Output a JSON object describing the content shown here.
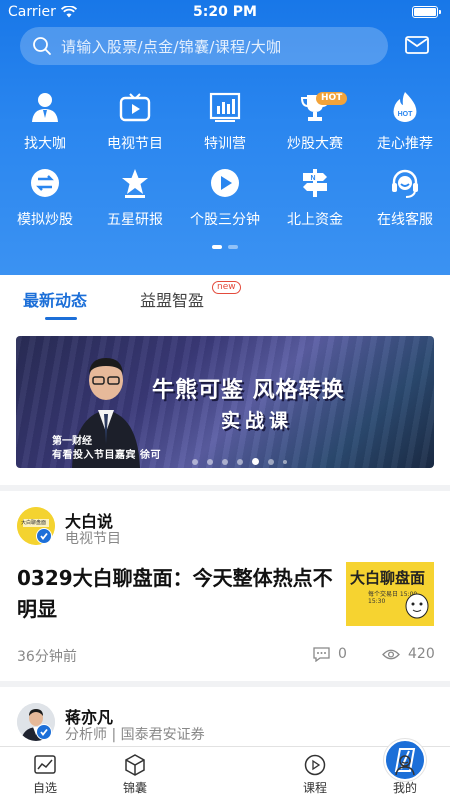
{
  "status_bar": {
    "carrier": "Carrier",
    "time": "5:20 PM"
  },
  "search": {
    "placeholder": "请输入股票/点金/锦囊/课程/大咖"
  },
  "grid": {
    "row1": [
      {
        "label": "找大咖",
        "icon": "person-icon"
      },
      {
        "label": "电视节目",
        "icon": "tv-icon"
      },
      {
        "label": "特训营",
        "icon": "chart-board-icon"
      },
      {
        "label": "炒股大赛",
        "icon": "trophy-icon",
        "badge": "HOT"
      },
      {
        "label": "走心推荐",
        "icon": "hot-flame-icon"
      }
    ],
    "row2": [
      {
        "label": "模拟炒股",
        "icon": "exchange-icon"
      },
      {
        "label": "五星研报",
        "icon": "star-icon"
      },
      {
        "label": "个股三分钟",
        "icon": "play-icon"
      },
      {
        "label": "北上资金",
        "icon": "signpost-icon"
      },
      {
        "label": "在线客服",
        "icon": "headset-icon"
      }
    ]
  },
  "tabs": {
    "active": "最新动态",
    "inactive": "益盟智盈",
    "new_badge": "new"
  },
  "banner": {
    "headline": "牛熊可鉴  风格转换",
    "subtitle": "实战课",
    "caption1": "第一财经",
    "caption2": "有看投入节目嘉宾  徐可"
  },
  "card1": {
    "author": "大白说",
    "author_sub": "电视节目",
    "title": "0329大白聊盘面：今天整体热点不明显",
    "thumb_title": "大白聊盘面",
    "thumb_sub": "每个交易日 15:00-15:30",
    "time": "36分钟前",
    "comments": "0",
    "views": "420",
    "avatar_text": "大白聊盘面"
  },
  "card2": {
    "author": "蒋亦凡",
    "author_sub": "分析师 | 国泰君安证券"
  },
  "bottom_nav": [
    {
      "label": "自选",
      "icon": "chart-line-icon"
    },
    {
      "label": "锦囊",
      "icon": "cube-icon"
    },
    {
      "label": "",
      "icon": "center-logo-icon"
    },
    {
      "label": "课程",
      "icon": "play-circle-icon"
    },
    {
      "label": "我的",
      "icon": "user-icon"
    }
  ],
  "colors": {
    "primary": "#1c6fd8",
    "header_blue": "#2a86ef",
    "hot_badge": "#f2a33a",
    "new_badge": "#e34b3c",
    "thumb_yellow": "#f6d330"
  }
}
